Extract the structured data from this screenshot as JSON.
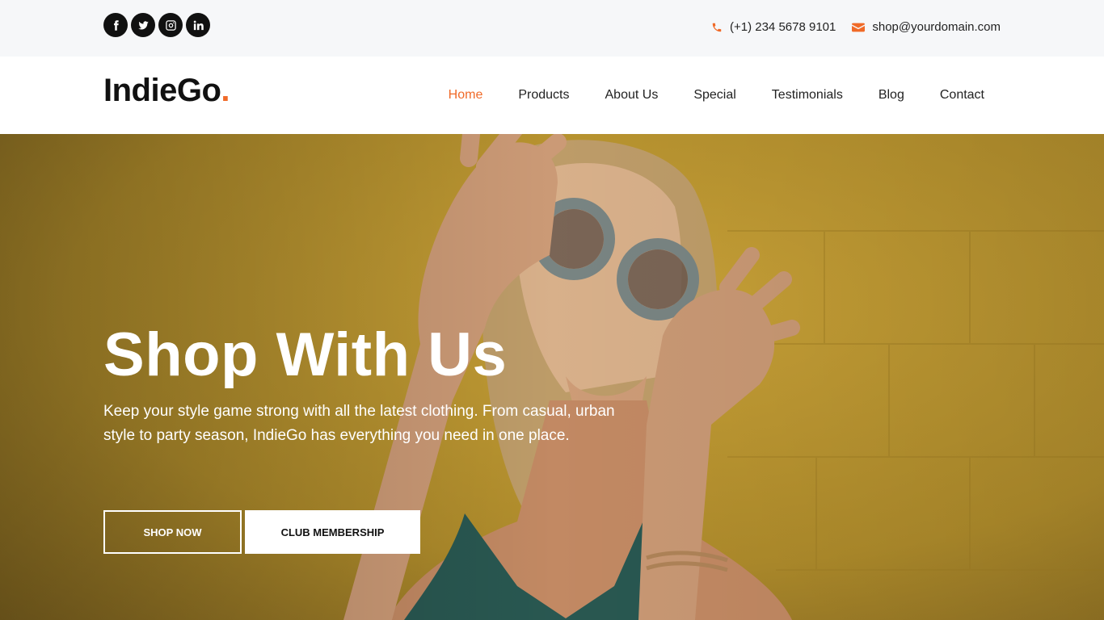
{
  "topbar": {
    "social": [
      "facebook-icon",
      "twitter-icon",
      "instagram-icon",
      "linkedin-icon"
    ],
    "phone": "(+1) 234 5678 9101",
    "email": "shop@yourdomain.com"
  },
  "brand": {
    "name": "IndieGo",
    "dot": ".",
    "accent": "#f06a28"
  },
  "nav": {
    "items": [
      "Home",
      "Products",
      "About Us",
      "Special",
      "Testimonials",
      "Blog",
      "Contact"
    ],
    "active": "Home"
  },
  "hero": {
    "title": "Shop With Us",
    "text": "Keep your style game strong with all the latest clothing. From casual, urban style to party season, IndieGo has everything you need in one place.",
    "primary_button": "SHOP NOW",
    "secondary_button": "CLUB MEMBERSHIP"
  }
}
